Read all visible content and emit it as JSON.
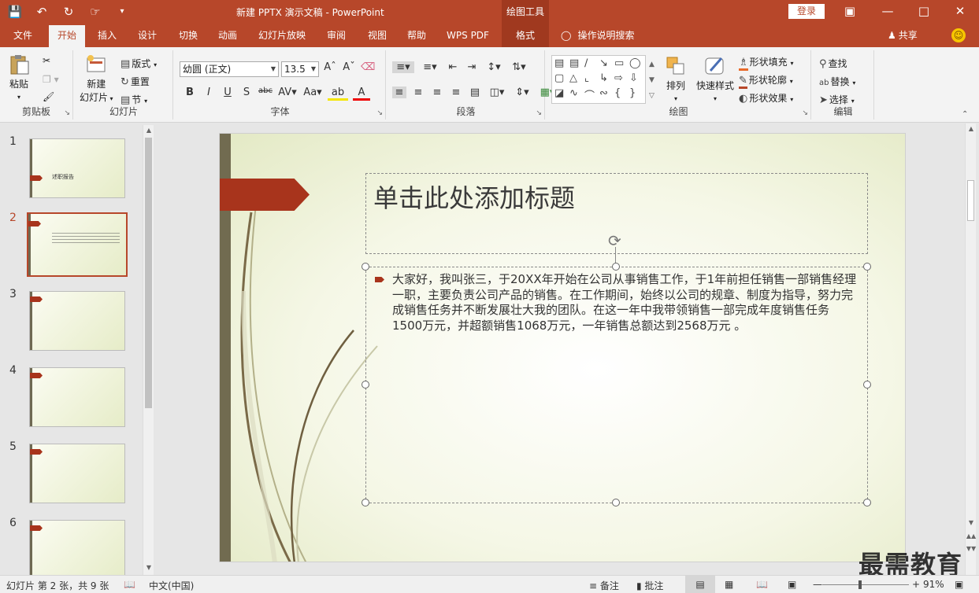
{
  "titlebar": {
    "title": "新建 PPTX 演示文稿  -  PowerPoint",
    "context_header": "绘图工具",
    "login": "登录",
    "qat_icons": [
      "save-icon",
      "undo-icon",
      "redo-icon",
      "touch-mode-icon",
      "customize-icon"
    ]
  },
  "tabs": [
    "文件",
    "开始",
    "插入",
    "设计",
    "切换",
    "动画",
    "幻灯片放映",
    "审阅",
    "视图",
    "帮助",
    "WPS PDF",
    "格式"
  ],
  "tab_active": "开始",
  "tellme": "操作说明搜索",
  "share": "共享",
  "ribbon": {
    "clipboard": {
      "label": "剪贴板",
      "paste": "粘贴"
    },
    "slides": {
      "label": "幻灯片",
      "new_slide": "新建",
      "new_slide2": "幻灯片",
      "layout": "版式",
      "reset": "重置",
      "section": "节"
    },
    "font": {
      "label": "字体",
      "font_name": "幼圆 (正文)",
      "font_size": "13.5"
    },
    "paragraph": {
      "label": "段落"
    },
    "drawing": {
      "label": "绘图",
      "arrange": "排列",
      "quick_styles": "快速样式",
      "shape_fill": "形状填充",
      "shape_outline": "形状轮廓",
      "shape_effects": "形状效果"
    },
    "editing": {
      "label": "编辑",
      "find": "查找",
      "replace": "替换",
      "select": "选择"
    }
  },
  "thumbnails": [
    {
      "num": "1",
      "title": "述职报告"
    },
    {
      "num": "2"
    },
    {
      "num": "3"
    },
    {
      "num": "4"
    },
    {
      "num": "5"
    },
    {
      "num": "6"
    }
  ],
  "selected_slide": "2",
  "slide": {
    "title_placeholder": "单击此处添加标题",
    "body_text": "大家好，我叫张三，于20XX年开始在公司从事销售工作，于1年前担任销售一部销售经理一职，主要负责公司产品的销售。在工作期间，始终以公司的规章、制度为指导，努力完成销售任务并不断发展壮大我的团队。在这一年中我带领销售一部完成年度销售任务1500万元，并超额销售1068万元，一年销售总额达到2568万元 。"
  },
  "statusbar": {
    "slide_info": "幻灯片 第 2 张，共 9 张",
    "language": "中文(中国)",
    "notes": "备注",
    "comments": "批注",
    "zoom": "91%",
    "zoom_value": 91
  },
  "watermark": "最需教育",
  "colors": {
    "accent": "#b7472a",
    "slide_bar": "#716b50",
    "flag": "#a8341c"
  }
}
